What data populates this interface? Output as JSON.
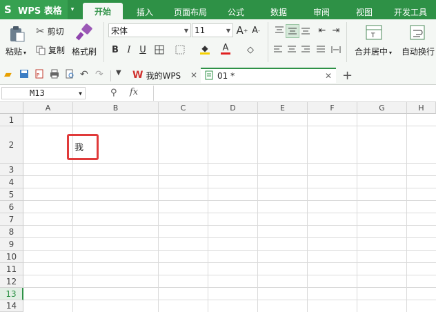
{
  "app": {
    "name": "WPS 表格",
    "logo_glyph": "S"
  },
  "ribbon_tabs": [
    {
      "label": "开始",
      "active": true
    },
    {
      "label": "插入"
    },
    {
      "label": "页面布局"
    },
    {
      "label": "公式"
    },
    {
      "label": "数据"
    },
    {
      "label": "审阅"
    },
    {
      "label": "视图"
    },
    {
      "label": "开发工具"
    }
  ],
  "clipboard": {
    "paste": "粘贴",
    "cut": "剪切",
    "copy": "复制",
    "format_painter": "格式刷"
  },
  "font": {
    "name": "宋体",
    "size": "11"
  },
  "alignment": {
    "merge_center": "合并居中",
    "wrap_text": "自动换行"
  },
  "doc_tabs": [
    {
      "label": "我的WPS"
    },
    {
      "label": "01 *",
      "active": true
    }
  ],
  "formula_bar": {
    "cell_ref": "M13",
    "fx": "fx"
  },
  "sheet": {
    "columns": [
      "A",
      "B",
      "C",
      "D",
      "E",
      "F",
      "G",
      "H"
    ],
    "rows": [
      "1",
      "2",
      "3",
      "4",
      "5",
      "6",
      "7",
      "8",
      "9",
      "10",
      "11",
      "12",
      "13",
      "14"
    ],
    "active_row": "13",
    "cell_B2": "我"
  },
  "colors": {
    "brand_green": "#2e9146",
    "highlight_red": "#e03a3a",
    "active_row": "#2e9146"
  }
}
